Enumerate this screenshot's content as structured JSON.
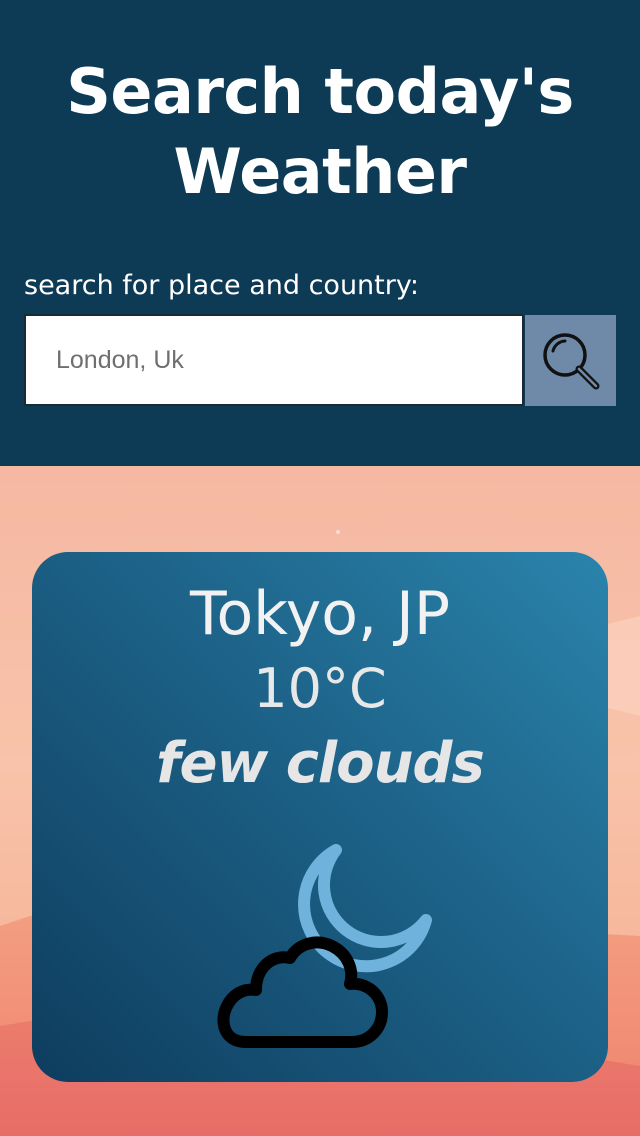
{
  "header": {
    "title_line1": "Search today's",
    "title_line2": "Weather",
    "search_label": "search for place and country:",
    "search_placeholder": "London, Uk",
    "search_button_icon": "magnifier-icon"
  },
  "weather": {
    "location": "Tokyo, JP",
    "temperature": "10°C",
    "description": "few clouds",
    "icon": "night-cloud-icon"
  },
  "colors": {
    "header_bg": "#0d3a55",
    "search_button_bg": "#6f8aa8",
    "card_dark": "#0e3d5e",
    "card_light": "#2a84ac",
    "moon": "#6fb3dc",
    "background_peach": "#f8c3aa"
  }
}
